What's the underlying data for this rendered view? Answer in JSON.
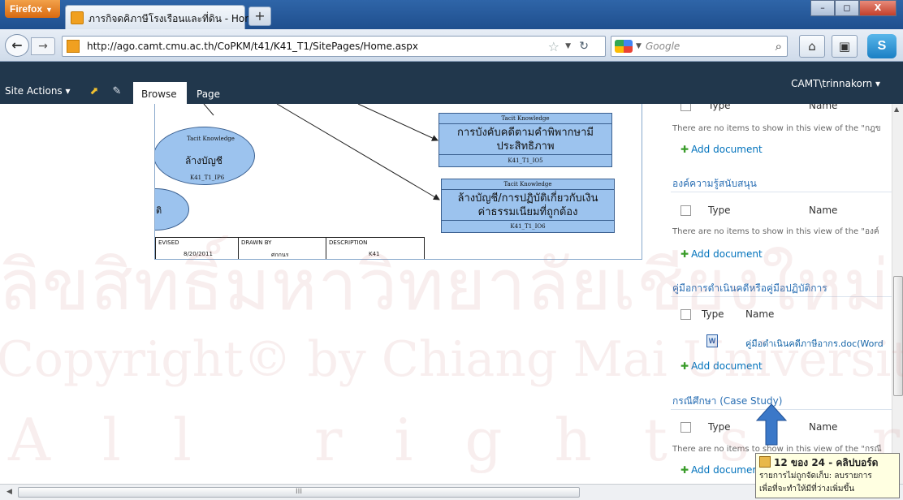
{
  "browser": {
    "menu_button": "Firefox",
    "tab_title": "ภารกิจดคิภาษีโรงเรือนและที่ดิน - Home",
    "new_tab": "+",
    "url": "http://ago.camt.cmu.ac.th/CoPKM/t41/K41_T1/SitePages/Home.aspx",
    "search_placeholder": "Google",
    "window_controls": [
      "–",
      "◻",
      "X"
    ]
  },
  "ribbon": {
    "site_actions": "Site Actions ▾",
    "tabs": [
      "Browse",
      "Page"
    ],
    "user": "CAMT\\trinnakorn ▾"
  },
  "diagram": {
    "ellipse1": {
      "label": "Tacit Knowledge",
      "title": "ล้างบัญชี",
      "id": "K41_T1_IP6"
    },
    "ellipse2": {
      "title": "ติ"
    },
    "box1": {
      "label": "Tacit Knowledge",
      "lines": [
        "การบังคับคดีตามคำพิพากษามี",
        "ประสิทธิภาพ"
      ],
      "id": "K41_T1_IO5"
    },
    "box2": {
      "label": "Tacit Knowledge",
      "lines": [
        "ล้างบัญชี/การปฏิบัติเกี่ยวกับเงิน",
        "ค่าธรรมเนียมที่ถูกต้อง"
      ],
      "id": "K41_T1_IO6"
    },
    "titleblock": {
      "revised_label": "EVISED",
      "revised_value": "8/20/2011",
      "drawn_label": "DRAWN BY",
      "drawn_value": "ศกกนร",
      "desc_label": "DESCRIPTION",
      "desc_value": "K41"
    }
  },
  "panel": {
    "col_type": "Type",
    "col_name": "Name",
    "add_document": "Add document",
    "add_document_cut": "Add documer",
    "empty_msgs": [
      "There are no items to show in this view of the \"กฎข",
      "There are no items to show in this view of the \"องค์",
      "There are no items to show in this view of the \"กรณี"
    ],
    "sections": [
      "องค์ความรู้สนับสนุน",
      "คู่มือการดำเนินคดีหรือคู่มือปฏิบัติการ",
      "กรณีศึกษา (Case Study)"
    ],
    "doc_link": "คู่มือดำเนินคดีภาษีอากร.doc(Word"
  },
  "watermark": {
    "line1": "ลิขสิทธิ์มหาวิทยาลัยเชียงใหม่",
    "line2": "Copyright© by Chiang Mai University",
    "line3": "All rights reserved"
  },
  "tooltip": {
    "title": "12 ของ 24 - คลิปบอร์ด",
    "line1": "รายการไม่ถูกจัดเก็บ: ลบรายการ",
    "line2": "เพื่อที่จะทำให้มีที่ว่างเพิ่มขึ้น"
  },
  "scrollbar": {
    "grip": "III"
  }
}
